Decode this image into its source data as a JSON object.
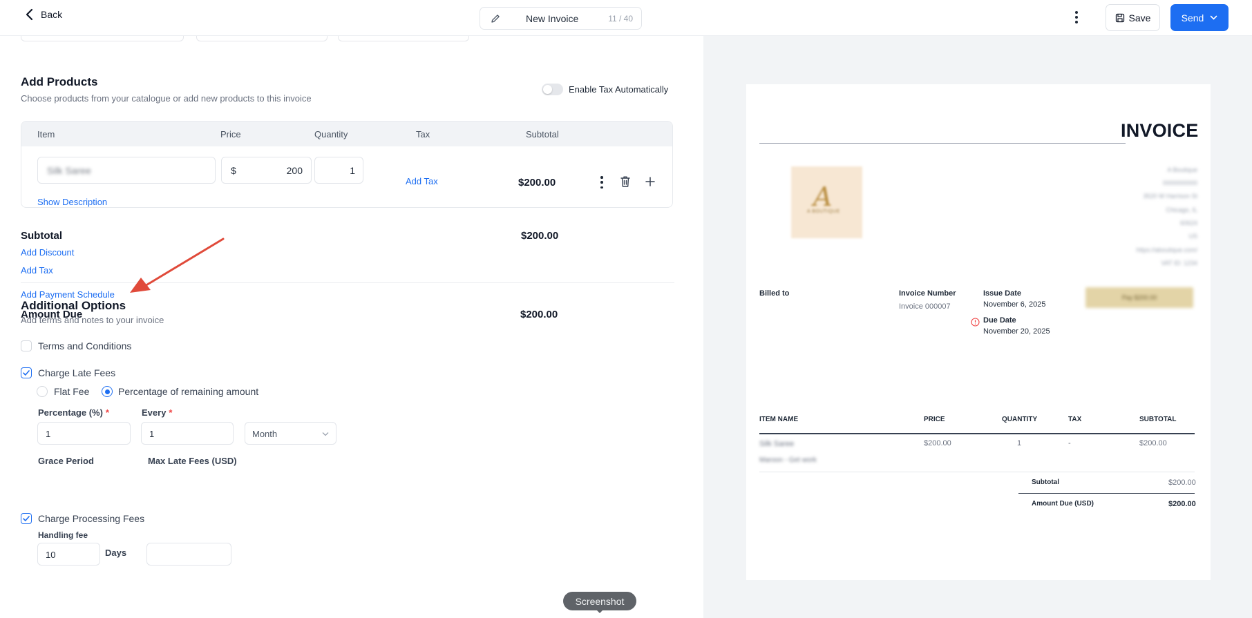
{
  "topbar": {
    "back_label": "Back",
    "doc_name": "New Invoice",
    "char_count": "11 / 40",
    "save_label": "Save",
    "send_label": "Send"
  },
  "products": {
    "title": "Add Products",
    "subtitle": "Choose products from your catalogue or add new products to this invoice",
    "tax_toggle_label": "Enable Tax Automatically",
    "tax_toggle_on": false,
    "columns": [
      "Item",
      "Price",
      "Quantity",
      "Tax",
      "Subtotal"
    ],
    "row": {
      "item": "Silk Saree",
      "currency": "$",
      "price": "200",
      "quantity": "1",
      "tax_link": "Add Tax",
      "subtotal": "$200.00",
      "show_description": "Show Description"
    }
  },
  "summary": {
    "subtotal_label": "Subtotal",
    "subtotal_value": "$200.00",
    "add_discount": "Add Discount",
    "add_tax": "Add Tax",
    "add_payment_schedule": "Add Payment Schedule",
    "amount_due_label": "Amount Due",
    "amount_due_value": "$200.00"
  },
  "options": {
    "title": "Additional Options",
    "subtitle": "Add terms and notes to your invoice",
    "terms_label": "Terms and Conditions",
    "terms_checked": false,
    "late_fees_label": "Charge Late Fees",
    "late_fees_checked": true,
    "flat_fee_label": "Flat Fee",
    "percentage_label": "Percentage of remaining amount",
    "selected_mode": "Percentage of remaining amount",
    "percentage_field_label": "Percentage (%)",
    "percentage_value": "1",
    "every_label": "Every",
    "every_value": "1",
    "period_value": "Month",
    "grace_label": "Grace Period",
    "grace_value": "10",
    "days_label": "Days",
    "max_late_label": "Max Late Fees (USD)",
    "max_late_value": "",
    "processing_label": "Charge Processing Fees",
    "processing_checked": true,
    "handling_label": "Handling fee"
  },
  "tooltip": "Screenshot",
  "preview": {
    "heading": "INVOICE",
    "logo_initial": "A",
    "logo_tagline": "A BOUTIQUE",
    "business_lines": [
      "A Boutique",
      "0000000000",
      "3520 W Harrison St",
      "Chicago, IL",
      "60624",
      "US",
      "https://aboutique.com/",
      "VAT ID: 1234"
    ],
    "billed_to_label": "Billed to",
    "invoice_number_label": "Invoice Number",
    "invoice_number_value": "Invoice 000007",
    "issue_date_label": "Issue Date",
    "issue_date_value": "November 6, 2025",
    "due_date_label": "Due Date",
    "due_date_value": "November 20, 2025",
    "pay_button": "Pay $200.00",
    "table_headers": [
      "ITEM NAME",
      "PRICE",
      "QUANTITY",
      "TAX",
      "SUBTOTAL"
    ],
    "line": {
      "name": "Silk Saree",
      "note": "Maroon - Get work",
      "price": "$200.00",
      "quantity": "1",
      "tax": "-",
      "subtotal": "$200.00"
    },
    "subtotal_label": "Subtotal",
    "subtotal_value": "$200.00",
    "amount_due_label": "Amount Due (USD)",
    "amount_due_value": "$200.00"
  },
  "colors": {
    "accent": "#1d6ef2",
    "annotation_arrow": "#e04a3a",
    "logo_bg": "#f7e7d3"
  }
}
